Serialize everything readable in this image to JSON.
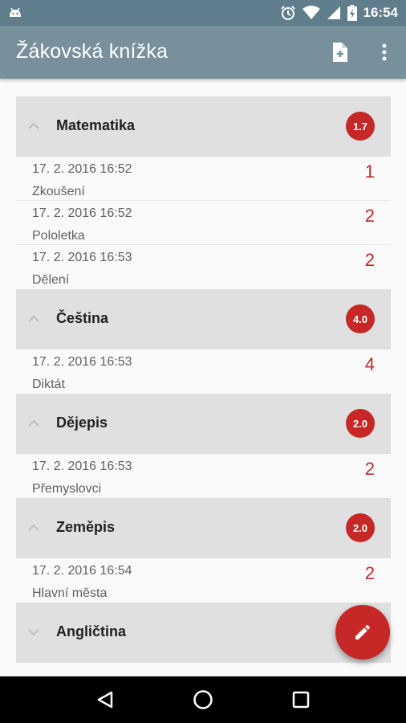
{
  "status_bar": {
    "time": "16:54",
    "icons": [
      "android-icon",
      "alarm-icon",
      "wifi-icon",
      "signal-icon",
      "battery-icon"
    ]
  },
  "app_bar": {
    "title": "Žákovská knížka",
    "actions": [
      "export-pdf-icon",
      "more-vert-icon"
    ]
  },
  "subjects": [
    {
      "name": "Matematika",
      "average": "1.7",
      "expanded": true,
      "entries": [
        {
          "date": "17. 2. 2016 16:52",
          "description": "Zkoušení",
          "grade": "1"
        },
        {
          "date": "17. 2. 2016 16:52",
          "description": "Pololetka",
          "grade": "2"
        },
        {
          "date": "17. 2. 2016 16:53",
          "description": "Dělení",
          "grade": "2"
        }
      ]
    },
    {
      "name": "Čeština",
      "average": "4.0",
      "expanded": true,
      "entries": [
        {
          "date": "17. 2. 2016 16:53",
          "description": "Diktát",
          "grade": "4"
        }
      ]
    },
    {
      "name": "Dějepis",
      "average": "2.0",
      "expanded": true,
      "entries": [
        {
          "date": "17. 2. 2016 16:53",
          "description": "Přemyslovci",
          "grade": "2"
        }
      ]
    },
    {
      "name": "Zeměpis",
      "average": "2.0",
      "expanded": true,
      "entries": [
        {
          "date": "17. 2. 2016 16:54",
          "description": "Hlavní města",
          "grade": "2"
        }
      ]
    },
    {
      "name": "Angličtina",
      "average": "",
      "expanded": false,
      "entries": []
    }
  ],
  "fab": {
    "icon": "pencil-icon"
  },
  "colors": {
    "status_bar": "#607d8b",
    "app_bar": "#78909c",
    "accent": "#c62828",
    "group_header": "#e0e0e0"
  }
}
